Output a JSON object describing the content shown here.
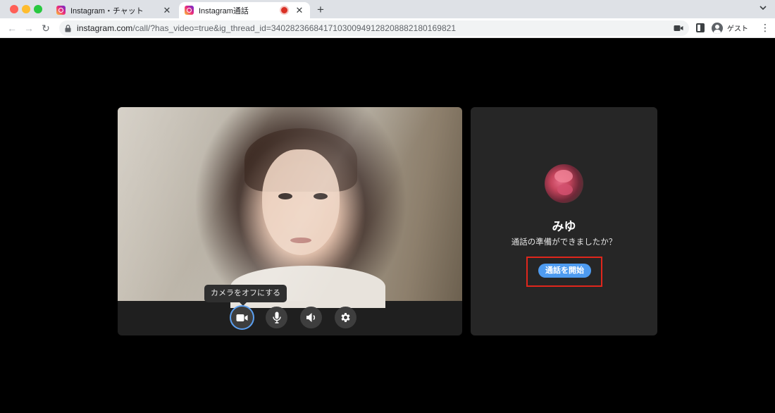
{
  "browser": {
    "tabs": [
      {
        "title": "Instagram・チャット",
        "active": false
      },
      {
        "title": "Instagram通話",
        "active": true,
        "recording": true
      }
    ],
    "url_host": "instagram.com",
    "url_path": "/call/?has_video=true&ig_thread_id=340282366841710300949128208882180169821",
    "profile_label": "ゲスト"
  },
  "video": {
    "tooltip": "カメラをオフにする",
    "controls": [
      "camera-icon",
      "microphone-icon",
      "speaker-icon",
      "gear-icon"
    ]
  },
  "call": {
    "callee_name": "みゆ",
    "prompt": "通話の準備ができましたか？",
    "start_button": "通話を開始"
  },
  "colors": {
    "accent": "#4e9bf0",
    "highlight": "#e0261c",
    "card_bg": "#262626",
    "page_bg": "#000000"
  }
}
